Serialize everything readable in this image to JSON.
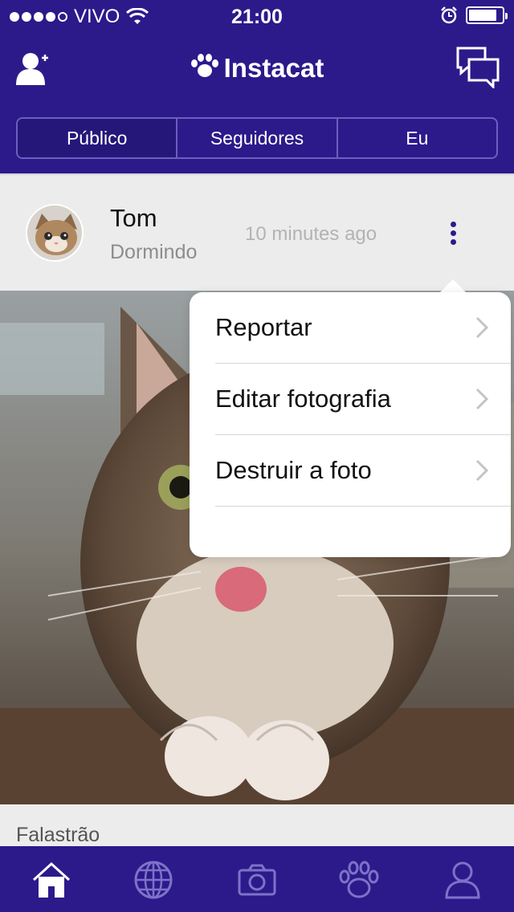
{
  "status_bar": {
    "carrier": "VIVO",
    "time": "21:00",
    "signal_bars": 4,
    "battery_level": 0.85,
    "icons": [
      "wifi-icon",
      "alarm-icon",
      "battery-icon"
    ]
  },
  "navbar": {
    "title": "Instacat",
    "left_icon": "add-user-icon",
    "right_icon": "messages-icon",
    "title_icon": "paw-icon"
  },
  "tabs": [
    {
      "label": "Público",
      "active": true
    },
    {
      "label": "Seguidores",
      "active": false
    },
    {
      "label": "Eu",
      "active": false
    }
  ],
  "post": {
    "user_name": "Tom",
    "user_status": "Dormindo",
    "time_ago": "10 minutes ago",
    "caption": "Falastrão"
  },
  "menu": {
    "items": [
      {
        "label": "Reportar"
      },
      {
        "label": "Editar fotografia"
      },
      {
        "label": "Destruir a foto"
      }
    ]
  },
  "tab_bar": {
    "items": [
      "home-icon",
      "globe-icon",
      "camera-icon",
      "paw-icon",
      "profile-icon"
    ],
    "active_index": 0
  },
  "colors": {
    "primary": "#2c1a8b",
    "accent": "#2c1a8b",
    "muted_text": "#8d8d8d"
  }
}
